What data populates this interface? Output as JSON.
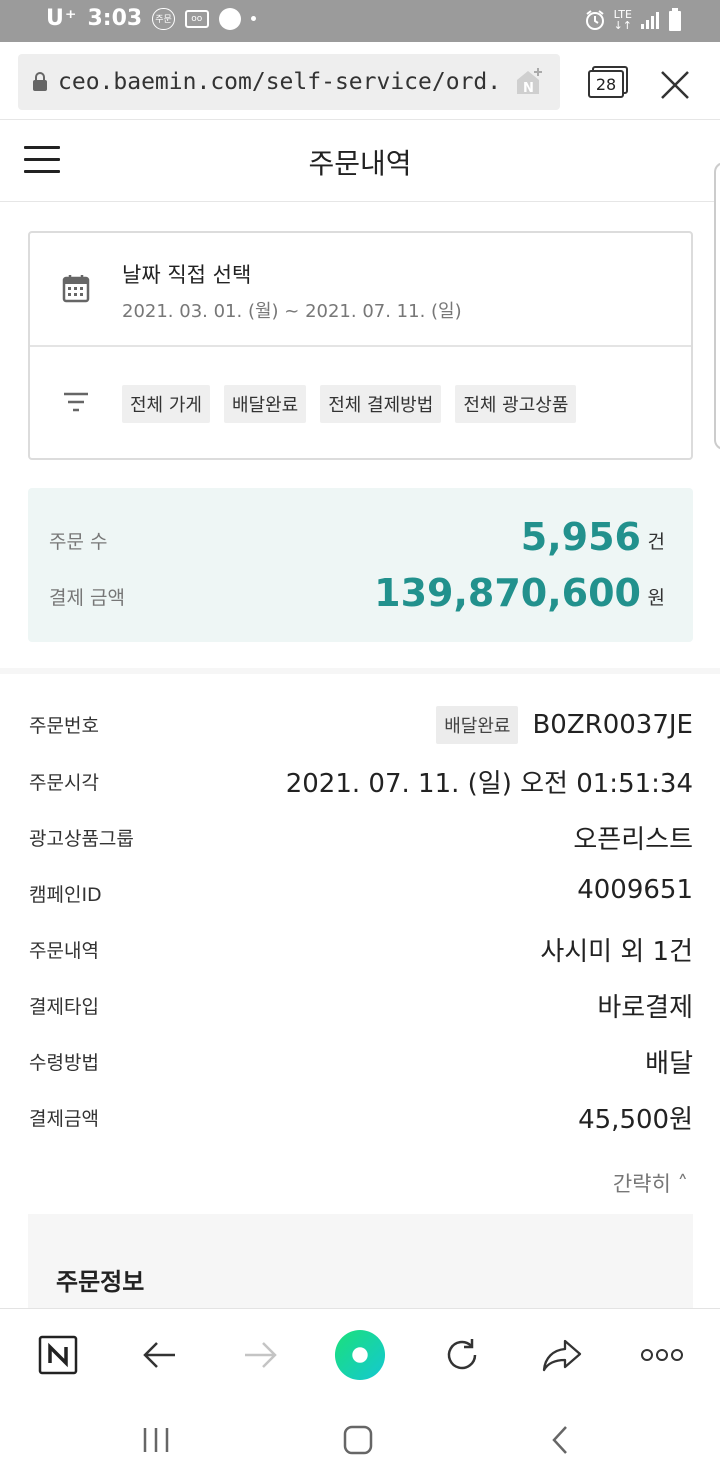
{
  "status_bar": {
    "carrier": "U⁺",
    "time": "3:03",
    "pill_label": "주문",
    "lte": "LTE"
  },
  "browser": {
    "url": "ceo.baemin.com/self-service/ord...",
    "tab_count": "28"
  },
  "header": {
    "title": "주문내역"
  },
  "filter": {
    "date_title": "날짜 직접 선택",
    "date_range": "2021. 03. 01. (월) ~ 2021. 07. 11. (일)",
    "chips": [
      "전체 가게",
      "배달완료",
      "전체 결제방법",
      "전체 광고상품"
    ]
  },
  "summary": {
    "order_count_label": "주문 수",
    "order_count_value": "5,956",
    "order_count_unit": "건",
    "amount_label": "결제 금액",
    "amount_value": "139,870,600",
    "amount_unit": "원",
    "accent_color": "#22918d"
  },
  "order": {
    "rows": [
      {
        "label": "주문번호",
        "badge": "배달완료",
        "value": "B0ZR0037JE"
      },
      {
        "label": "주문시각",
        "value": "2021. 07. 11. (일) 오전 01:51:34"
      },
      {
        "label": "광고상품그룹",
        "value": "오픈리스트"
      },
      {
        "label": "캠페인ID",
        "value": "4009651"
      },
      {
        "label": "주문내역",
        "value": "사시미 외 1건"
      },
      {
        "label": "결제타입",
        "value": "바로결제"
      },
      {
        "label": "수령방법",
        "value": "배달"
      },
      {
        "label": "결제금액",
        "value": "45,500원"
      }
    ],
    "collapse_label": "간략히 ˄",
    "info_title": "주문정보"
  },
  "toolbar": {
    "icons": [
      "naver-home-icon",
      "back-arrow-icon",
      "forward-arrow-icon",
      "green-dot-icon",
      "refresh-icon",
      "share-icon",
      "more-icon"
    ]
  }
}
